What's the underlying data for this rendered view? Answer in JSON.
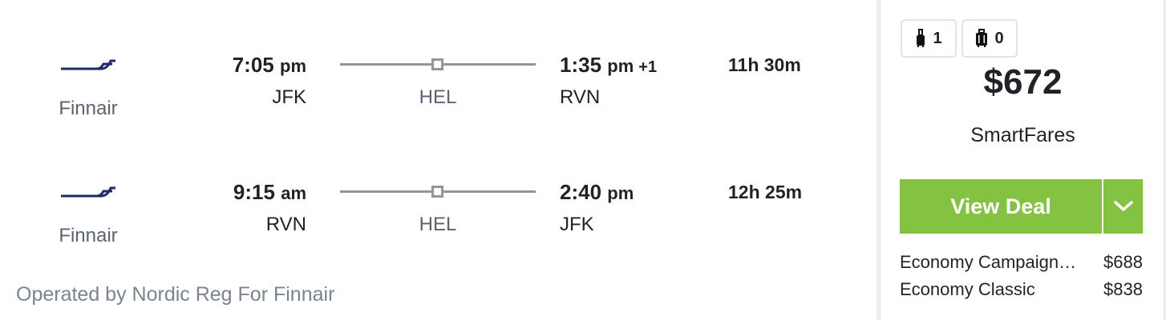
{
  "legs": [
    {
      "airline": "Finnair",
      "logo_icon": "finnair-logo-icon",
      "depart_time": "7:05",
      "depart_ampm": "pm",
      "depart_code": "JFK",
      "stop_code": "HEL",
      "arrive_time": "1:35",
      "arrive_ampm": "pm",
      "arrive_day_offset": "+1",
      "arrive_code": "RVN",
      "duration": "11h 30m"
    },
    {
      "airline": "Finnair",
      "logo_icon": "finnair-logo-icon",
      "depart_time": "9:15",
      "depart_ampm": "am",
      "depart_code": "RVN",
      "stop_code": "HEL",
      "arrive_time": "2:40",
      "arrive_ampm": "pm",
      "arrive_day_offset": "",
      "arrive_code": "JFK",
      "duration": "12h 25m"
    }
  ],
  "operated_by": "Operated by Nordic Reg For Finnair",
  "bags": {
    "carry_on": {
      "icon": "carry-on-bag-icon",
      "count": "1"
    },
    "checked": {
      "icon": "checked-bag-icon",
      "count": "0"
    }
  },
  "price": "$672",
  "provider": "SmartFares",
  "deal_button_label": "View Deal",
  "deal_dropdown_icon": "chevron-down-icon",
  "fares": [
    {
      "name": "Economy Campaign…",
      "price": "$688"
    },
    {
      "name": "Economy Classic",
      "price": "$838"
    }
  ],
  "colors": {
    "accent_green": "#84c342",
    "logo_navy": "#1b2a6b",
    "route_gray": "#8f979f"
  }
}
